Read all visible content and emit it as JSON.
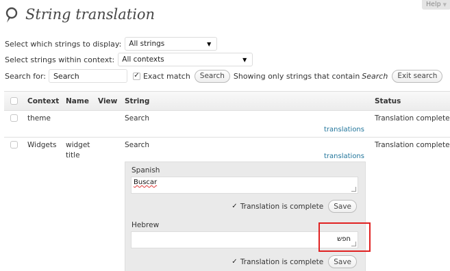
{
  "help": {
    "label": "Help"
  },
  "title": "String translation",
  "filters": {
    "display_label": "Select which strings to display:",
    "display_value": "All strings",
    "context_label": "Select strings within context:",
    "context_value": "All contexts",
    "search_label": "Search for:",
    "search_value": "Search",
    "exact_match_label": "Exact match",
    "exact_match_checked": true,
    "search_button": "Search",
    "showing_text": "Showing only strings that contain",
    "showing_term": "Search",
    "exit_button": "Exit search"
  },
  "table": {
    "headers": {
      "context": "Context",
      "name": "Name",
      "view": "View",
      "string": "String",
      "status": "Status"
    },
    "rows": [
      {
        "context": "theme",
        "name": "",
        "view": "",
        "string": "Search",
        "translations_link": "translations",
        "status": "Translation complete"
      },
      {
        "context": "Widgets",
        "name": "widget title",
        "name_line1": "widget",
        "name_line2": "title",
        "view": "",
        "string": "Search",
        "translations_link": "translations",
        "status": "Translation complete"
      }
    ]
  },
  "editor": {
    "languages": [
      {
        "name": "Spanish",
        "value": "Buscar",
        "complete_label": "Translation is complete",
        "complete_checked": true,
        "save_label": "Save"
      },
      {
        "name": "Hebrew",
        "value": "חפש",
        "complete_label": "Translation is complete",
        "complete_checked": true,
        "save_label": "Save"
      }
    ]
  },
  "colors": {
    "link": "#21759b",
    "highlight": "#e02020",
    "header_bg": "#ececec"
  }
}
